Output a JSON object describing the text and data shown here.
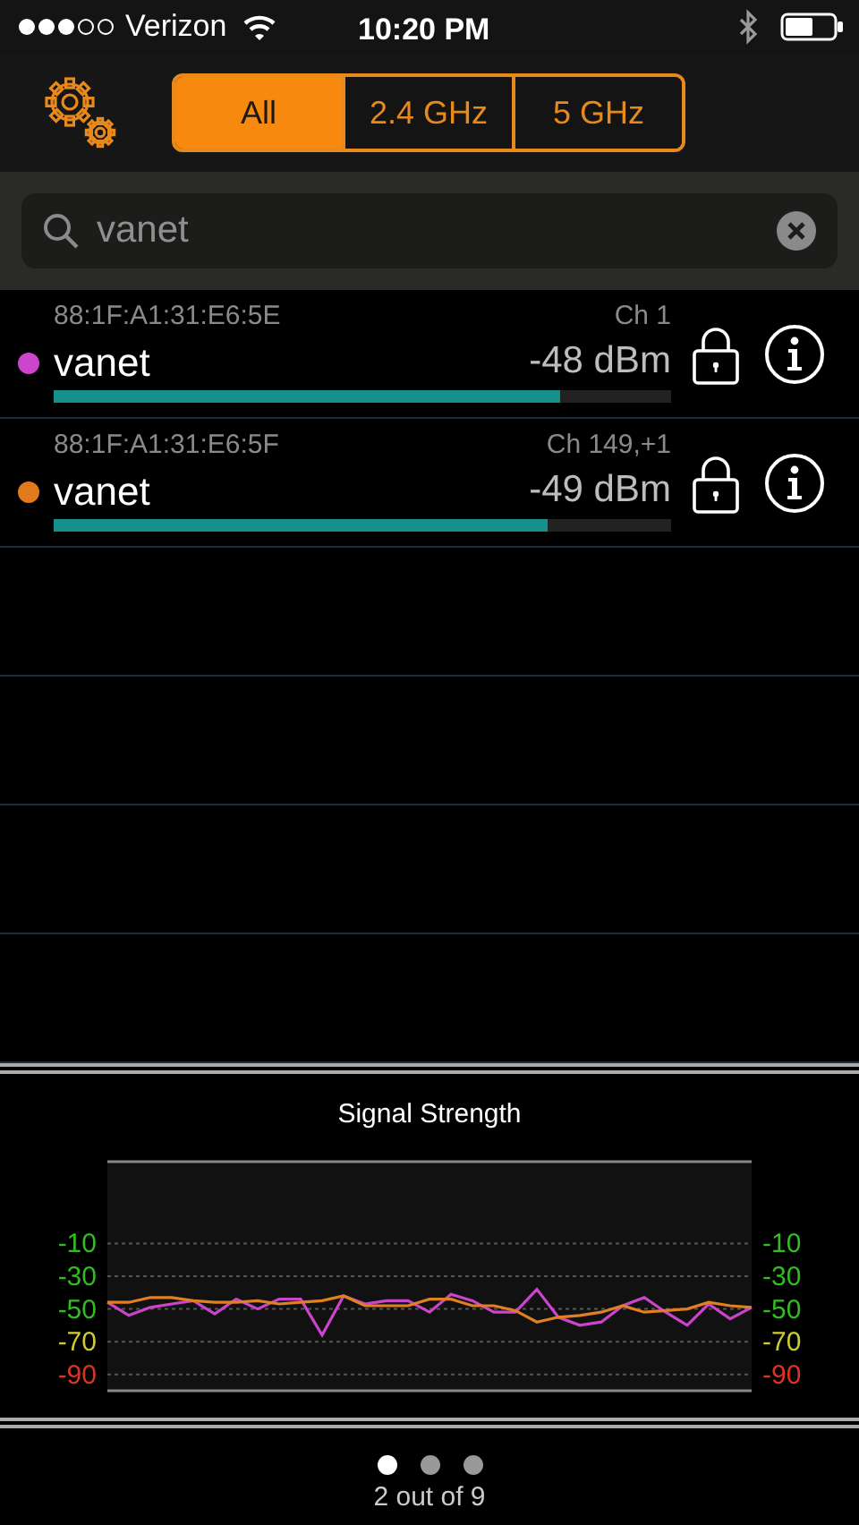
{
  "status_bar": {
    "carrier": "Verizon",
    "time": "10:20 PM"
  },
  "tabs": [
    {
      "label": "All",
      "selected": true
    },
    {
      "label": "2.4 GHz",
      "selected": false
    },
    {
      "label": "5 GHz",
      "selected": false
    }
  ],
  "search": {
    "value": "vanet"
  },
  "networks": [
    {
      "mac": "88:1F:A1:31:E6:5E",
      "channel": "Ch 1",
      "name": "vanet",
      "reading": "-48 dBm",
      "level": 0.82,
      "color": "#cc44cc",
      "locked": true
    },
    {
      "mac": "88:1F:A1:31:E6:5F",
      "channel": "Ch 149,+1",
      "name": "vanet",
      "reading": "-49 dBm",
      "level": 0.8,
      "color": "#e07a1a",
      "locked": true
    }
  ],
  "chart": {
    "chart_data": {
      "type": "line",
      "title": "Signal Strength",
      "ylim": [
        -100,
        40
      ],
      "yticks": [
        -10,
        -30,
        -50,
        -70,
        -90
      ],
      "grid": true,
      "series": [
        {
          "color": "#cc44cc",
          "values": [
            -46,
            -54,
            -49,
            -47,
            -45,
            -53,
            -44,
            -50,
            -44,
            -44,
            -66,
            -42,
            -47,
            -45,
            -45,
            -52,
            -41,
            -45,
            -52,
            -52,
            -38,
            -55,
            -60,
            -58,
            -48,
            -43,
            -52,
            -60,
            -47,
            -56,
            -49
          ]
        },
        {
          "color": "#e08020",
          "values": [
            -46,
            -46,
            -43,
            -43,
            -45,
            -46,
            -46,
            -45,
            -47,
            -46,
            -45,
            -42,
            -48,
            -48,
            -48,
            -44,
            -44,
            -48,
            -48,
            -51,
            -58,
            -55,
            -54,
            -52,
            -48,
            -52,
            -51,
            -50,
            -46,
            -48,
            -49
          ]
        }
      ]
    }
  },
  "right_axis_labels": [
    "-10",
    "-30",
    "-50",
    "-70",
    "-90"
  ],
  "pager": {
    "pages": [
      {
        "selected": true
      },
      {
        "selected": false
      },
      {
        "selected": false
      }
    ],
    "label": "2 out of 9"
  }
}
